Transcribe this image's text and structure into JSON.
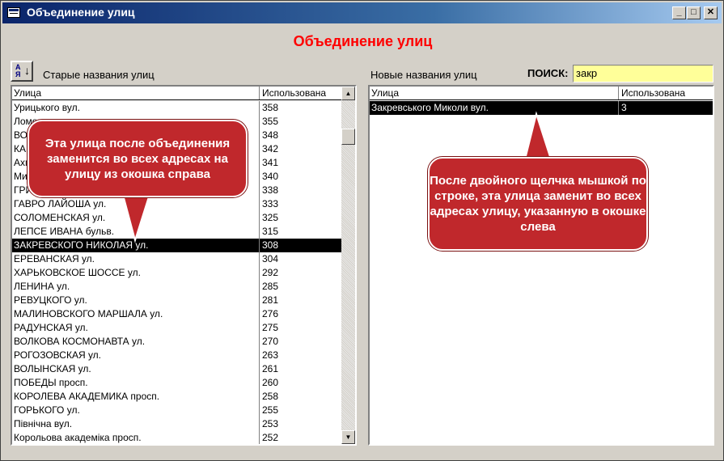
{
  "window": {
    "title": "Объединение улиц"
  },
  "heading": "Объединение улиц",
  "labels": {
    "old_streets": "Старые названия улиц",
    "new_streets": "Новые названия улиц",
    "search": "ПОИСК:"
  },
  "search": {
    "value": "закр"
  },
  "sort_button": {
    "glyph_az": "A\nЯ",
    "arrow": "↓"
  },
  "left_grid": {
    "headers": {
      "street": "Улица",
      "used": "Использована"
    },
    "rows": [
      {
        "street": "Урицького вул.",
        "used": "358"
      },
      {
        "street": "Ломоносова вул.",
        "used": "355"
      },
      {
        "street": "ВОРОШИЛОВА ул.",
        "used": "348"
      },
      {
        "street": "КАРЛА МАРКСА ул.",
        "used": "342"
      },
      {
        "street": "Ахматовой ул.",
        "used": "341"
      },
      {
        "street": "Мичурина ул.",
        "used": "340"
      },
      {
        "street": "ГРИГОРЕНКО ул.",
        "used": "338"
      },
      {
        "street": "ГАВРО ЛАЙОША ул.",
        "used": "333"
      },
      {
        "street": "СОЛОМЕНСКАЯ ул.",
        "used": "325"
      },
      {
        "street": "ЛЕПСЕ ИВАНА бульв.",
        "used": "315"
      },
      {
        "street": "ЗАКРЕВСКОГО НИКОЛАЯ ул.",
        "used": "308"
      },
      {
        "street": "ЕРЕВАНСКАЯ ул.",
        "used": "304"
      },
      {
        "street": "ХАРЬКОВСКОЕ ШОССЕ ул.",
        "used": "292"
      },
      {
        "street": "ЛЕНИНА ул.",
        "used": "285"
      },
      {
        "street": "РЕВУЦКОГО ул.",
        "used": "281"
      },
      {
        "street": "МАЛИНОВСКОГО МАРШАЛА ул.",
        "used": "276"
      },
      {
        "street": "РАДУНСКАЯ ул.",
        "used": "275"
      },
      {
        "street": "ВОЛКОВА КОСМОНАВТА ул.",
        "used": "270"
      },
      {
        "street": "РОГОЗОВСКАЯ ул.",
        "used": "263"
      },
      {
        "street": "ВОЛЫНСКАЯ ул.",
        "used": "261"
      },
      {
        "street": "ПОБЕДЫ просп.",
        "used": "260"
      },
      {
        "street": "КОРОЛЕВА АКАДЕМИКА просп.",
        "used": "258"
      },
      {
        "street": "ГОРЬКОГО ул.",
        "used": "255"
      },
      {
        "street": "Північна вул.",
        "used": "253"
      },
      {
        "street": "Корольова академіка просп.",
        "used": "252"
      }
    ],
    "selected_index": 10
  },
  "right_grid": {
    "headers": {
      "street": "Улица",
      "used": "Использована"
    },
    "rows": [
      {
        "street": "Закревського Миколи вул.",
        "used": "3"
      }
    ],
    "selected_index": 0
  },
  "callouts": {
    "left": "Эта улица после объединения заменится во всех адресах на улицу из окошка справа",
    "right": "После двойного щелчка мышкой по строке, эта улица заменит во всех адресах улицу, указанную в окошке слева"
  },
  "colors": {
    "heading": "#ff0000",
    "callout": "#c0282c",
    "search_bg": "#ffff99",
    "selected_row": "#000000"
  }
}
